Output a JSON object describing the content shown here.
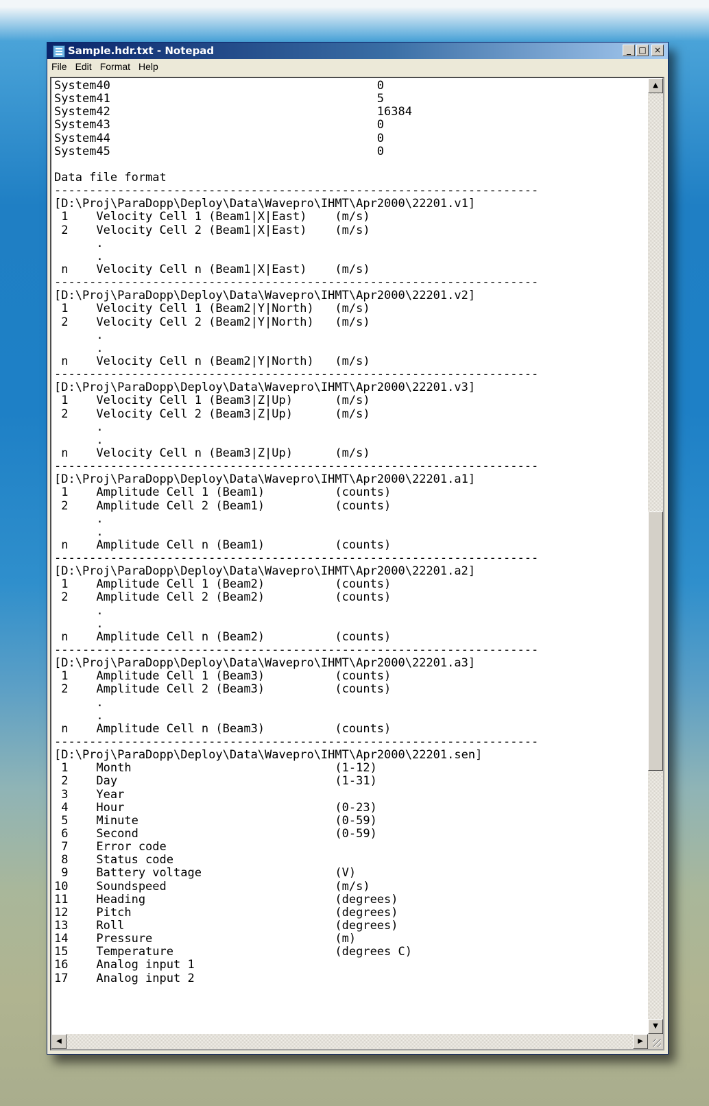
{
  "window": {
    "title": "Sample.hdr.txt - Notepad",
    "controls": {
      "minimize": "_",
      "maximize": "□",
      "close": "×"
    }
  },
  "menu": [
    "File",
    "Edit",
    "Format",
    "Help"
  ],
  "document": {
    "lines": [
      "System40                                      0",
      "System41                                      5",
      "System42                                      16384",
      "System43                                      0",
      "System44                                      0",
      "System45                                      0",
      "",
      "Data file format",
      "---------------------------------------------------------------------",
      "[D:\\Proj\\ParaDopp\\Deploy\\Data\\Wavepro\\IHMT\\Apr2000\\22201.v1]",
      " 1    Velocity Cell 1 (Beam1|X|East)    (m/s)",
      " 2    Velocity Cell 2 (Beam1|X|East)    (m/s)",
      "      .",
      "      .",
      " n    Velocity Cell n (Beam1|X|East)    (m/s)",
      "---------------------------------------------------------------------",
      "[D:\\Proj\\ParaDopp\\Deploy\\Data\\Wavepro\\IHMT\\Apr2000\\22201.v2]",
      " 1    Velocity Cell 1 (Beam2|Y|North)   (m/s)",
      " 2    Velocity Cell 2 (Beam2|Y|North)   (m/s)",
      "      .",
      "      .",
      " n    Velocity Cell n (Beam2|Y|North)   (m/s)",
      "---------------------------------------------------------------------",
      "[D:\\Proj\\ParaDopp\\Deploy\\Data\\Wavepro\\IHMT\\Apr2000\\22201.v3]",
      " 1    Velocity Cell 1 (Beam3|Z|Up)      (m/s)",
      " 2    Velocity Cell 2 (Beam3|Z|Up)      (m/s)",
      "      .",
      "      .",
      " n    Velocity Cell n (Beam3|Z|Up)      (m/s)",
      "---------------------------------------------------------------------",
      "[D:\\Proj\\ParaDopp\\Deploy\\Data\\Wavepro\\IHMT\\Apr2000\\22201.a1]",
      " 1    Amplitude Cell 1 (Beam1)          (counts)",
      " 2    Amplitude Cell 2 (Beam1)          (counts)",
      "      .",
      "      .",
      " n    Amplitude Cell n (Beam1)          (counts)",
      "---------------------------------------------------------------------",
      "[D:\\Proj\\ParaDopp\\Deploy\\Data\\Wavepro\\IHMT\\Apr2000\\22201.a2]",
      " 1    Amplitude Cell 1 (Beam2)          (counts)",
      " 2    Amplitude Cell 2 (Beam2)          (counts)",
      "      .",
      "      .",
      " n    Amplitude Cell n (Beam2)          (counts)",
      "---------------------------------------------------------------------",
      "[D:\\Proj\\ParaDopp\\Deploy\\Data\\Wavepro\\IHMT\\Apr2000\\22201.a3]",
      " 1    Amplitude Cell 1 (Beam3)          (counts)",
      " 2    Amplitude Cell 2 (Beam3)          (counts)",
      "      .",
      "      .",
      " n    Amplitude Cell n (Beam3)          (counts)",
      "---------------------------------------------------------------------",
      "[D:\\Proj\\ParaDopp\\Deploy\\Data\\Wavepro\\IHMT\\Apr2000\\22201.sen]",
      " 1    Month                             (1-12)",
      " 2    Day                               (1-31)",
      " 3    Year",
      " 4    Hour                              (0-23)",
      " 5    Minute                            (0-59)",
      " 6    Second                            (0-59)",
      " 7    Error code",
      " 8    Status code",
      " 9    Battery voltage                   (V)",
      "10    Soundspeed                        (m/s)",
      "11    Heading                           (degrees)",
      "12    Pitch                             (degrees)",
      "13    Roll                              (degrees)",
      "14    Pressure                          (m)",
      "15    Temperature                       (degrees C)",
      "16    Analog input 1",
      "17    Analog input 2"
    ]
  },
  "scrollbars": {
    "up_arrow": "▲",
    "down_arrow": "▼",
    "left_arrow": "◀",
    "right_arrow": "▶",
    "vertical_position": 0.58
  },
  "colors": {
    "title_active": "#0a246a",
    "title_gradient_end": "#a6caf0",
    "chrome": "#ece9d8"
  }
}
